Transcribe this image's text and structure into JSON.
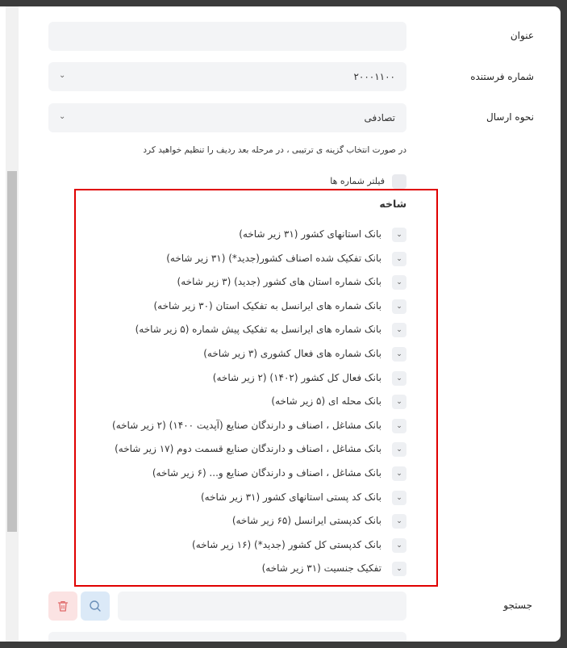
{
  "form": {
    "title_label": "عنوان",
    "title_value": "",
    "sender_label": "شماره فرستنده",
    "sender_value": "۲۰۰۰۱۱۰۰",
    "send_mode_label": "نحوه ارسال",
    "send_mode_value": "تصادفی",
    "hint": "در صورت انتخاب گزینه ی ترتیبی ، در مرحله بعد ردیف را تنظیم خواهید کرد",
    "filter_label": "فیلتر شماره ها",
    "filter_checked": false
  },
  "branch": {
    "title": "شاخه",
    "items": [
      "بانک استانهای کشور (۳۱ زیر شاخه)",
      "بانک تفکیک شده اصناف کشور(جدید*) (۳۱ زیر شاخه)",
      "بانک شماره استان های کشور (جدید) (۳ زیر شاخه)",
      "بانک شماره های ایرانسل به تفکیک استان (۳۰ زیر شاخه)",
      "بانک شماره های ایرانسل به تفکیک پیش شماره (۵ زیر شاخه)",
      "بانک شماره های فعال کشوری (۳ زیر شاخه)",
      "بانک فعال کل کشور (۱۴۰۲) (۲ زیر شاخه)",
      "بانک محله ای (۵ زیر شاخه)",
      "بانک مشاغل ، اصناف و دارندگان صنایع (آپدیت ۱۴۰۰) (۲ زیر شاخه)",
      "بانک مشاغل ، اصناف و دارندگان صنایع قسمت دوم (۱۷ زیر شاخه)",
      "بانک مشاغل ، اصناف و دارندگان صنایع و... (۶ زیر شاخه)",
      "بانک کد پستی استانهای کشور (۳۱ زیر شاخه)",
      "بانک کدپستی ایرانسل (۶۵ زیر شاخه)",
      "بانک کدپستی کل کشور (جدید*) (۱۶ زیر شاخه)",
      "تفکیک جنسیت (۳۱ زیر شاخه)"
    ],
    "expand_icon": "chevron-down-icon"
  },
  "search": {
    "label": "جستجو",
    "value": "",
    "search_icon": "search-icon",
    "delete_icon": "trash-icon"
  },
  "colors": {
    "highlight": "#e00000",
    "search_button_bg": "#dbe9f7",
    "delete_button_bg": "#fbe3e3",
    "delete_icon": "#e06a6a",
    "search_icon": "#6b8fb8"
  }
}
